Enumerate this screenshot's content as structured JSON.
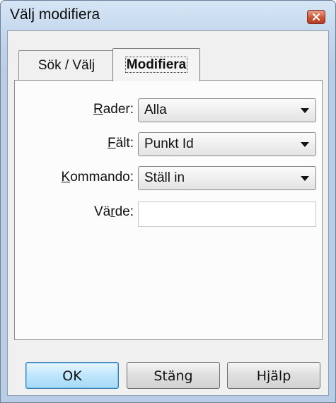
{
  "window": {
    "title": "Välj modifiera"
  },
  "tabs": [
    {
      "label": "Sök / Välj",
      "active": false
    },
    {
      "label": "Modifiera",
      "active": true
    }
  ],
  "form": {
    "rader": {
      "label_u": "R",
      "label_rest": "ader:",
      "value": "Alla"
    },
    "falt": {
      "label_u": "F",
      "label_rest": "ält:",
      "value": "Punkt Id"
    },
    "kommando": {
      "label_u": "K",
      "label_rest": "ommando:",
      "value": "Ställ in"
    },
    "varde": {
      "label_pre": "Vä",
      "label_u": "r",
      "label_rest": "de:",
      "value": ""
    }
  },
  "buttons": {
    "ok": "OK",
    "close": "Stäng",
    "help": "Hjälp"
  },
  "icons": {
    "close": "close-icon",
    "dropdown": "chevron-down-icon"
  }
}
